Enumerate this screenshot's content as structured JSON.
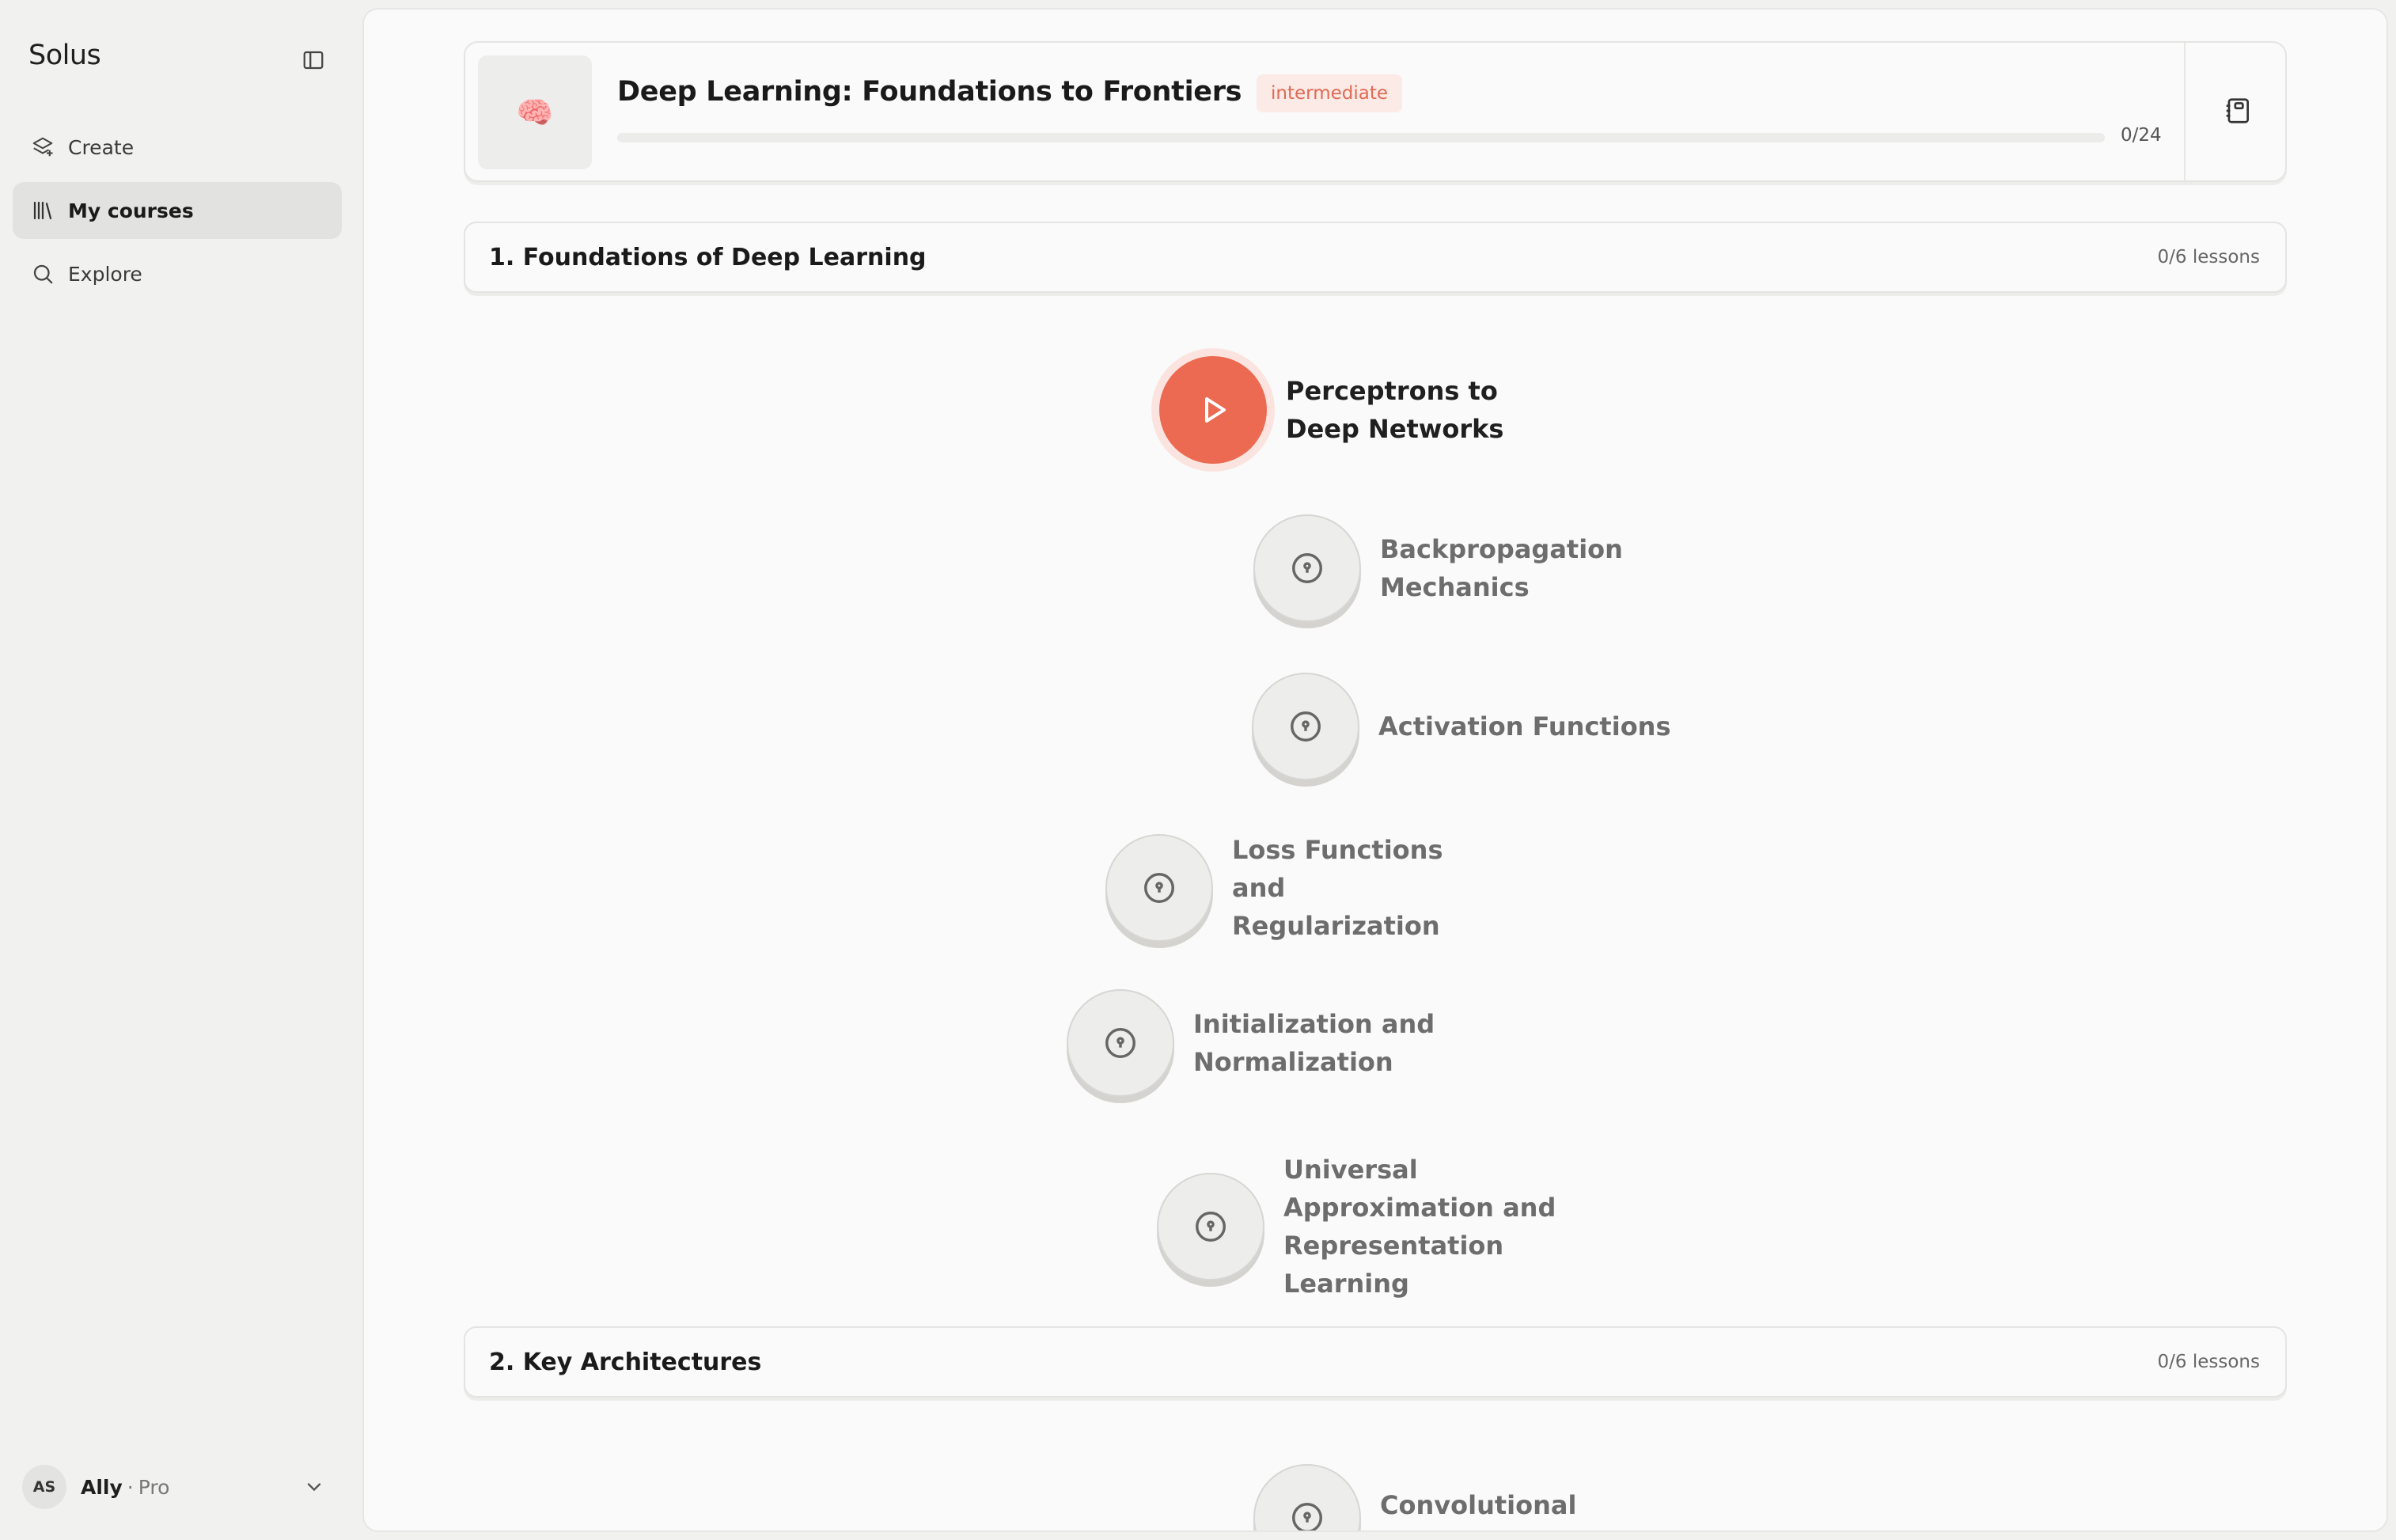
{
  "sidebar": {
    "brand": "Solus",
    "nav": [
      {
        "label": "Create",
        "icon": "layers-plus-icon"
      },
      {
        "label": "My courses",
        "icon": "library-icon",
        "active": true
      },
      {
        "label": "Explore",
        "icon": "search-icon"
      }
    ],
    "user": {
      "initials": "AS",
      "name": "Ally",
      "separator": "·",
      "plan": "Pro"
    }
  },
  "course": {
    "emoji": "🧠",
    "title": "Deep Learning: Foundations to Frontiers",
    "level": "intermediate",
    "progress_text": "0/24",
    "progress_fraction": 0
  },
  "units": [
    {
      "title": "1. Foundations of Deep Learning",
      "count": "0/6 lessons",
      "lessons": [
        {
          "label": "Perceptrons to Deep Networks",
          "state": "active"
        },
        {
          "label": "Backpropagation Mechanics",
          "state": "locked"
        },
        {
          "label": "Activation Functions",
          "state": "locked"
        },
        {
          "label": "Loss Functions and Regularization",
          "state": "locked"
        },
        {
          "label": "Initialization and Normalization",
          "state": "locked"
        },
        {
          "label": "Universal Approximation and Representation Learning",
          "state": "locked"
        }
      ]
    },
    {
      "title": "2. Key Architectures",
      "count": "0/6 lessons",
      "lessons": [
        {
          "label": "Convolutional Neural Networks",
          "state": "locked"
        }
      ]
    }
  ],
  "colors": {
    "accent": "#ec6a52",
    "badge_bg": "#fbeae6",
    "badge_text": "#e06a53"
  }
}
